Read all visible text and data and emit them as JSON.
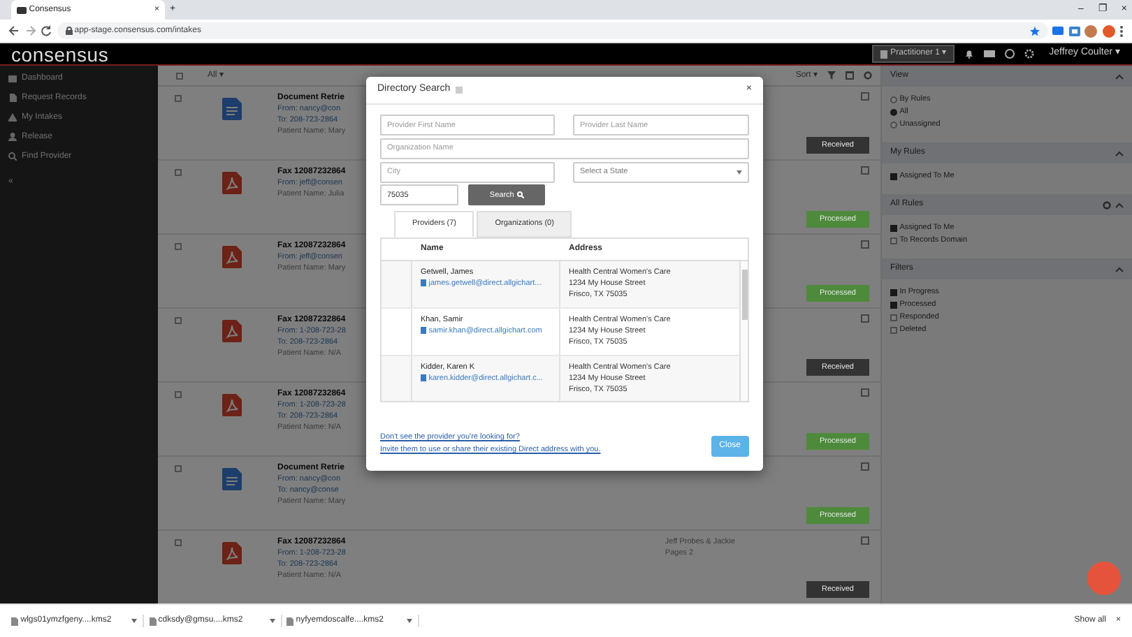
{
  "browser": {
    "tab_title": "Consensus",
    "tab_close": "×",
    "new_tab": "+",
    "url": "app-stage.consensus.com/intakes",
    "window_controls": [
      "–",
      "❐",
      "×"
    ]
  },
  "header": {
    "logo": "consensus",
    "facility": "Practitioner 1 ▾",
    "user": "Jeffrey Coulter ▾"
  },
  "sidebar": {
    "items": [
      {
        "label": "Dashboard"
      },
      {
        "label": "Request Records"
      },
      {
        "label": "My Intakes"
      },
      {
        "label": "Release"
      },
      {
        "label": "Find Provider"
      }
    ],
    "collapse": "«"
  },
  "list": {
    "filter": "All ▾",
    "sort": "Sort ▾",
    "select_all_checked": false,
    "rows": [
      {
        "kind": "doc",
        "checked": false,
        "title": "Document Retrie",
        "lines": [
          "From: nancy@con",
          "To: 208-723-2864",
          "Patient Name: Mary"
        ],
        "note": [],
        "status": "Received",
        "color": "#333333"
      },
      {
        "kind": "fax",
        "checked": false,
        "title": "Fax 12087232864",
        "lines": [
          "From: jeff@consen",
          "Patient Name: Julia"
        ],
        "note": [],
        "status": "Processed",
        "color": "#4e8a3c"
      },
      {
        "kind": "fax",
        "checked": false,
        "title": "Fax 12087232864",
        "lines": [
          "From: jeff@consen",
          "Patient Name: Mary"
        ],
        "note": [],
        "status": "Processed",
        "color": "#4e8a3c"
      },
      {
        "kind": "fax",
        "checked": false,
        "title": "Fax 12087232864",
        "lines": [
          "From: 1-208-723-28",
          "To: 208-723-2864",
          "Patient Name: N/A"
        ],
        "note": [],
        "status": "Received",
        "color": "#333333"
      },
      {
        "kind": "fax",
        "checked": false,
        "title": "Fax 12087232864",
        "lines": [
          "From: 1-208-723-28",
          "To: 208-723-2864",
          "Patient Name: N/A"
        ],
        "note": [],
        "status": "Processed",
        "color": "#4e8a3c"
      },
      {
        "kind": "doc",
        "checked": false,
        "title": "Document Retrie",
        "lines": [
          "From: nancy@con",
          "To: nancy@conse",
          "Patient Name: Mary"
        ],
        "note": [],
        "status": "Processed",
        "color": "#4e8a3c"
      },
      {
        "kind": "fax",
        "checked": false,
        "title": "Fax 12087232864",
        "lines": [
          "From: 1-208-723-28",
          "To: 208-723-2864",
          "Patient Name: N/A"
        ],
        "note": [
          "Jeff Probes & Jackie",
          "Pages 2"
        ],
        "status": "Received",
        "color": "#333333"
      }
    ]
  },
  "panel": {
    "sections": [
      {
        "title": "View",
        "gear": false,
        "items": [
          {
            "kind": "radio",
            "label": "By Rules",
            "selected": false
          },
          {
            "kind": "radio",
            "label": "All",
            "selected": true
          },
          {
            "kind": "radio",
            "label": "Unassigned",
            "selected": false
          }
        ]
      },
      {
        "title": "My Rules",
        "gear": false,
        "items": [
          {
            "kind": "checkbox",
            "label": "Assigned To Me",
            "checked": true
          }
        ]
      },
      {
        "title": "All Rules",
        "gear": true,
        "items": [
          {
            "kind": "checkbox",
            "label": "Assigned To Me",
            "checked": true
          },
          {
            "kind": "checkbox",
            "label": "To Records Domain",
            "checked": false
          }
        ]
      },
      {
        "title": "Filters",
        "gear": false,
        "items": [
          {
            "kind": "checkbox",
            "label": "In Progress",
            "checked": true
          },
          {
            "kind": "checkbox",
            "label": "Processed",
            "checked": true
          },
          {
            "kind": "checkbox",
            "label": "Responded",
            "checked": false
          },
          {
            "kind": "checkbox",
            "label": "Deleted",
            "checked": false
          }
        ]
      }
    ]
  },
  "modal": {
    "title": "Directory Search",
    "close": "×",
    "fields": {
      "first_name": {
        "placeholder": "Provider First Name"
      },
      "last_name": {
        "placeholder": "Provider Last Name"
      },
      "organization": {
        "placeholder": "Organization Name"
      },
      "city": {
        "placeholder": "City"
      },
      "state": {
        "placeholder": "Select a State"
      },
      "zip": {
        "value": "75035"
      }
    },
    "search_button": "Search",
    "tabs": [
      {
        "label": "Providers (7)",
        "selected": true
      },
      {
        "label": "Organizations (0)",
        "selected": false
      }
    ],
    "columns": [
      "Name",
      "Address"
    ],
    "results": [
      {
        "name": "Getwell, James",
        "email": "james.getwell@direct.allgichart...",
        "address": [
          "Health Central Women's Care",
          "1234 My House Street",
          "Frisco, TX 75035"
        ]
      },
      {
        "name": "Khan, Samir",
        "email": "samir.khan@direct.allgichart.com",
        "address": [
          "Health Central Women's Care",
          "1234 My House Street",
          "Frisco, TX 75035"
        ]
      },
      {
        "name": "Kidder, Karen K",
        "email": "karen.kidder@direct.allgichart.c...",
        "address": [
          "Health Central Women's Care",
          "1234 My House Street",
          "Frisco, TX 75035"
        ]
      }
    ],
    "footer_links": [
      "Don't see the provider you're looking for?",
      "Invite them to use or share their existing Direct address with you."
    ],
    "close_button": "Close"
  },
  "downloads": {
    "files": [
      "wlgs01ymzfgeny....kms2",
      "cdksdy@gmsu....kms2",
      "nyfyemdoscalfe....kms2"
    ],
    "show_all": "Show all",
    "close": "×"
  }
}
